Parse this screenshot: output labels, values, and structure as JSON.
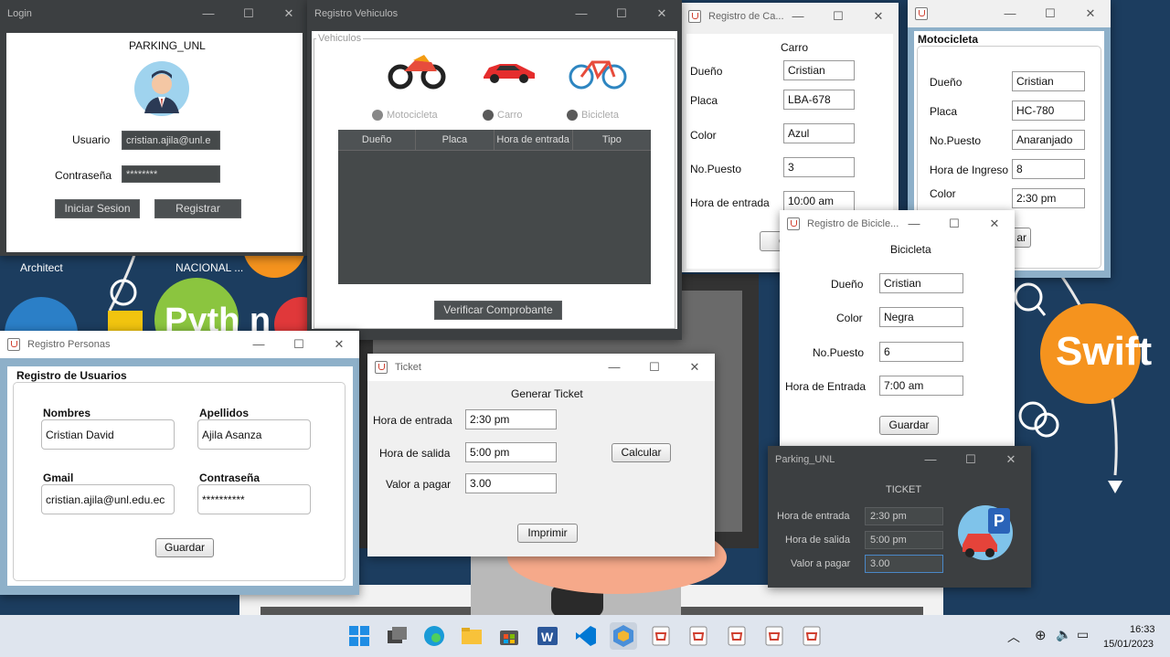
{
  "desktop": {
    "icons": [
      "Architect",
      "NACIONAL ..."
    ],
    "swift_label": "Swift",
    "python_label": "Pyth n"
  },
  "login": {
    "title": "Login",
    "app_name": "PARKING_UNL",
    "usuario_label": "Usuario",
    "usuario_value": "cristian.ajila@unl.e",
    "password_label": "Contraseña",
    "password_value": "********",
    "login_button": "Iniciar Sesion",
    "register_button": "Registrar"
  },
  "vehiculos": {
    "title": "Registro Vehiculos",
    "group_title": "Vehiculos",
    "radios": [
      "Motocicleta",
      "Carro",
      "Bicicleta"
    ],
    "columns": [
      "Dueño",
      "Placa",
      "Hora de entrada",
      "Tipo"
    ],
    "verify_button": "Verificar Comprobante"
  },
  "carro": {
    "title": "Registro de Ca...",
    "heading": "Carro",
    "fields": [
      {
        "label": "Dueño",
        "value": "Cristian"
      },
      {
        "label": "Placa",
        "value": "LBA-678"
      },
      {
        "label": "Color",
        "value": "Azul"
      },
      {
        "label": "No.Puesto",
        "value": "3"
      },
      {
        "label": "Hora de entrada",
        "value": "10:00 am"
      }
    ],
    "button_partial": "Gu"
  },
  "moto": {
    "heading": "Motocicleta",
    "fields": [
      {
        "label": "Dueño",
        "value": "Cristian"
      },
      {
        "label": "Placa",
        "value": "HC-780"
      },
      {
        "label": "No.Puesto",
        "value": "Anaranjado"
      },
      {
        "label": "Hora de Ingreso",
        "value": "8"
      },
      {
        "label": "Color",
        "value": "2:30 pm"
      }
    ],
    "button_partial": "ar"
  },
  "bici": {
    "title": "Registro de Bicicle...",
    "heading": "Bicicleta",
    "fields": [
      {
        "label": "Dueño",
        "value": "Cristian"
      },
      {
        "label": "Color",
        "value": "Negra"
      },
      {
        "label": "No.Puesto",
        "value": "6"
      },
      {
        "label": "Hora de Entrada",
        "value": "7:00 am"
      }
    ],
    "save_button": "Guardar"
  },
  "personas": {
    "title": "Registro Personas",
    "group_title": "Registro de Usuarios",
    "nombres_label": "Nombres",
    "nombres_value": "Cristian David",
    "apellidos_label": "Apellidos",
    "apellidos_value": "Ajila Asanza",
    "gmail_label": "Gmail",
    "gmail_value": "cristian.ajila@unl.edu.ec",
    "password_label": "Contraseña",
    "password_value": "**********",
    "save_button": "Guardar"
  },
  "ticket": {
    "title": "Ticket",
    "heading": "Generar Ticket",
    "entrada_label": "Hora de entrada",
    "entrada_value": "2:30 pm",
    "salida_label": "Hora de salida",
    "salida_value": "5:00 pm",
    "valor_label": "Valor a pagar",
    "valor_value": "3.00",
    "calc_button": "Calcular",
    "print_button": "Imprimir"
  },
  "parking": {
    "title": "Parking_UNL",
    "heading": "TICKET",
    "entrada_label": "Hora de entrada",
    "entrada_value": "2:30 pm",
    "salida_label": "Hora de salida",
    "salida_value": "5:00 pm",
    "valor_label": "Valor a pagar",
    "valor_value": "3.00",
    "badge_letter": "P"
  },
  "taskbar": {
    "time": "16:33",
    "date": "15/01/2023",
    "icons": [
      "windows-start-icon",
      "task-view-icon",
      "edge-icon",
      "file-explorer-icon",
      "store-icon",
      "word-icon",
      "vscode-icon",
      "netbeans-icon",
      "java-icon",
      "java-icon",
      "java-icon",
      "java-icon",
      "java-icon"
    ]
  },
  "colors": {
    "desktop_bg": "#1c3d5f",
    "orange": "#f5931e",
    "dark_panel": "#3c3f41",
    "table_dark": "#45494a"
  }
}
